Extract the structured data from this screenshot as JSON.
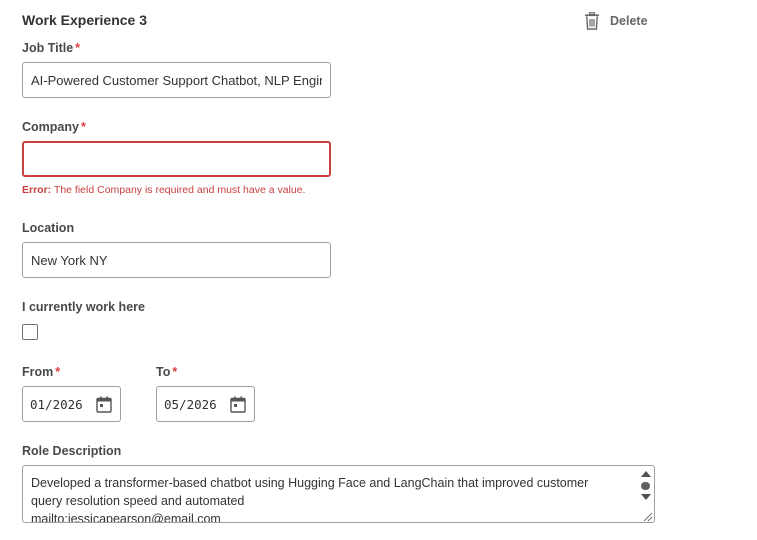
{
  "section": {
    "title": "Work Experience 3",
    "delete_label": "Delete"
  },
  "fields": {
    "job_title": {
      "label": "Job Title",
      "required_marker": "*",
      "value": "AI-Powered Customer Support Chatbot, NLP Engine"
    },
    "company": {
      "label": "Company",
      "required_marker": "*",
      "value": "",
      "error_prefix": "Error:",
      "error_text": "The field Company is required and must have a value."
    },
    "location": {
      "label": "Location",
      "value": "New York NY"
    },
    "current": {
      "label": "I currently work here",
      "checked": false
    },
    "from": {
      "label": "From",
      "required_marker": "*",
      "value": "01/2026"
    },
    "to": {
      "label": "To",
      "required_marker": "*",
      "value": "05/2026"
    },
    "role_description": {
      "label": "Role Description",
      "lines": [
        "Developed a transformer-based chatbot using Hugging Face and LangChain that improved customer",
        "query resolution speed and automated",
        "mailto:jessicapearson@email.com"
      ]
    }
  },
  "colors": {
    "required": "#de3d3d",
    "error": "#c94141",
    "border": "#a0a0a0"
  },
  "icons": {
    "delete": "trash-icon",
    "date": "calendar-icon"
  }
}
